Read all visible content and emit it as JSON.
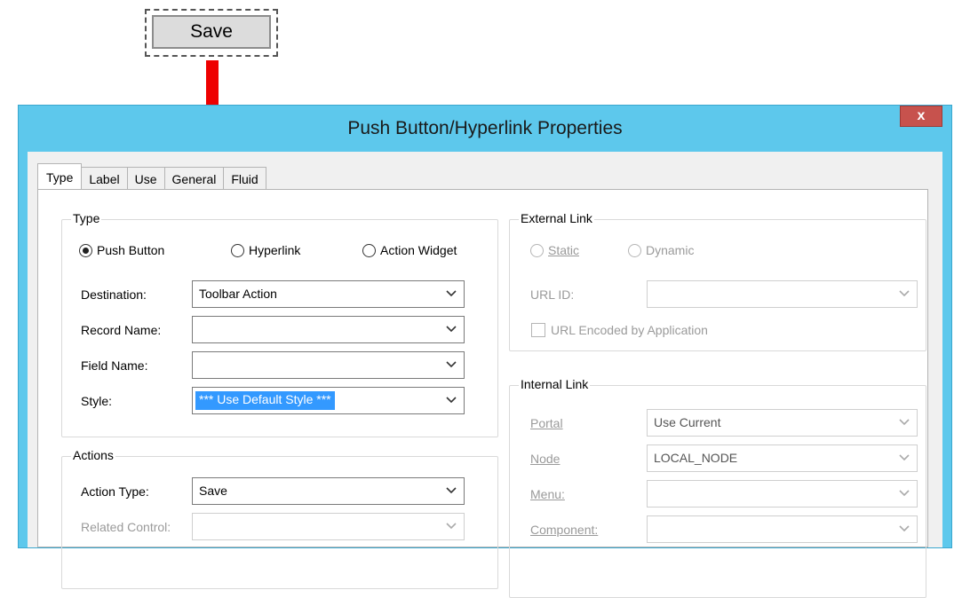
{
  "top_button": {
    "label": "Save"
  },
  "dialog": {
    "title": "Push Button/Hyperlink Properties",
    "close_label": "x",
    "tabs": [
      {
        "label": "Type",
        "active": true
      },
      {
        "label": "Label"
      },
      {
        "label": "Use"
      },
      {
        "label": "General"
      },
      {
        "label": "Fluid"
      }
    ],
    "type_group": {
      "title": "Type",
      "radios": [
        {
          "label": "Push Button",
          "checked": true
        },
        {
          "label": "Hyperlink",
          "checked": false
        },
        {
          "label": "Action Widget",
          "checked": false
        }
      ],
      "fields": [
        {
          "label": "Destination:",
          "value": "Toolbar Action"
        },
        {
          "label": "Record Name:",
          "value": ""
        },
        {
          "label": "Field Name:",
          "value": ""
        },
        {
          "label": "Style:",
          "value": "*** Use Default Style ***"
        }
      ]
    },
    "actions_group": {
      "title": "Actions",
      "action_type_label": "Action Type:",
      "action_type_value": "Save",
      "related_control_label": "Related Control:",
      "related_control_value": ""
    },
    "external_link": {
      "title": "External Link",
      "static_label": "Static",
      "dynamic_label": "Dynamic",
      "url_id_label": "URL ID:",
      "url_id_value": "",
      "url_encoded_label": "URL Encoded by Application"
    },
    "internal_link": {
      "title": "Internal Link",
      "fields": [
        {
          "label": "Portal",
          "value": "Use Current"
        },
        {
          "label": "Node",
          "value": "LOCAL_NODE"
        },
        {
          "label": "Menu:",
          "value": ""
        },
        {
          "label": "Component:",
          "value": ""
        }
      ]
    }
  },
  "colors": {
    "titlebar": "#5dc8ec",
    "close": "#c7524d",
    "arrow": "#ee0000",
    "selection": "#3399ff"
  }
}
